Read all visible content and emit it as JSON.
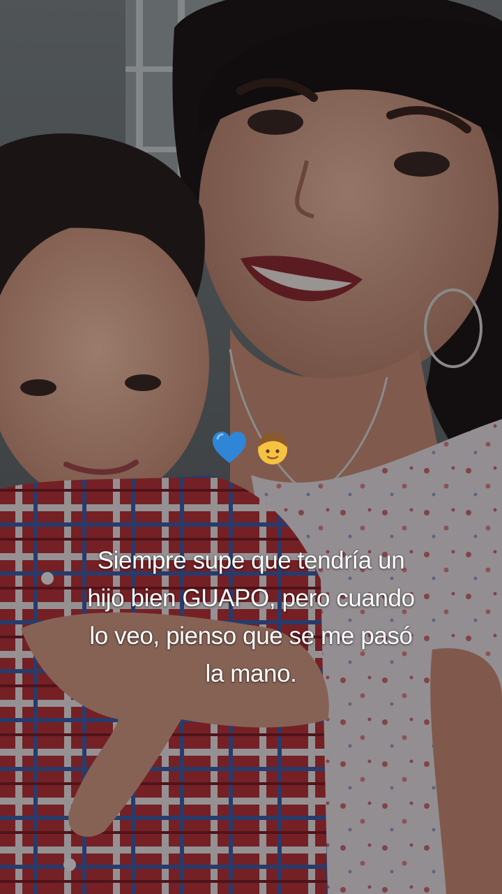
{
  "overlay": {
    "emojis": [
      "blue-heart",
      "boy"
    ],
    "caption_lines": [
      "Siempre supe que tendría un",
      "hijo bien GUAPO, pero cuando",
      "lo veo, pienso que se me pasó",
      "la mano."
    ]
  },
  "colors": {
    "caption_text": "#ffffff",
    "heart": "#2f86d6",
    "background_tint": "#1c1a1b"
  }
}
